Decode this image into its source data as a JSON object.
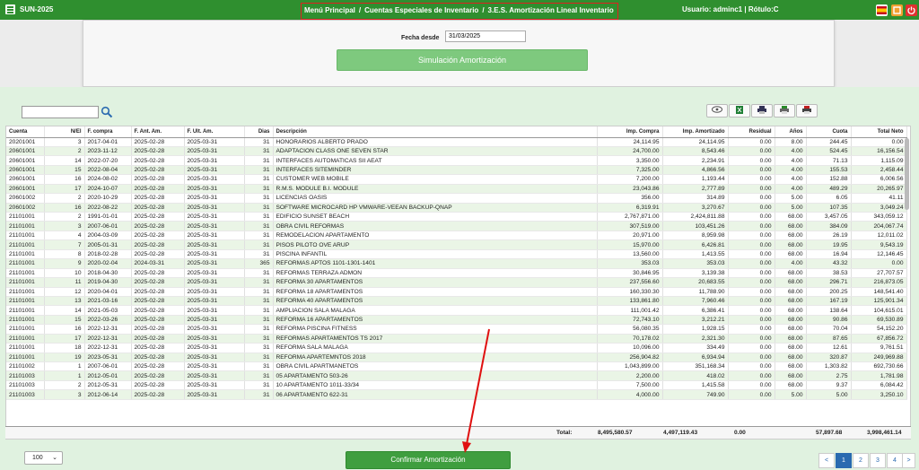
{
  "header": {
    "app_name": "SUN-2025",
    "breadcrumb": [
      "Menú Principal",
      "Cuentas Especiales de Inventario",
      "3.E.S. Amortización Lineal Inventario"
    ],
    "breadcrumb_sep": "/",
    "user_info": "Usuario: adminc1 | Rótulo:C",
    "colors": {
      "bar": "#2f8f2f",
      "highlight": "#e02020"
    }
  },
  "form": {
    "fecha_label": "Fecha desde",
    "fecha_value": "31/03/2025",
    "sim_button": "Simulación Amortización"
  },
  "table": {
    "columns": [
      "Cuenta",
      "N/El",
      "F. compra",
      "F. Ant. Am.",
      "F. Ult. Am.",
      "Dias",
      "Descripción",
      "Imp. Compra",
      "Imp. Amortizado",
      "Residual",
      "Años",
      "Cuota",
      "Total Neto"
    ],
    "rows": [
      [
        "20201001",
        "3",
        "2017-04-01",
        "2025-02-28",
        "2025-03-31",
        "31",
        "HONORARIOS ALBERTO PRADO",
        "24,114.95",
        "24,114.95",
        "0.00",
        "8.00",
        "244.45",
        "0.00"
      ],
      [
        "20601001",
        "2",
        "2023-11-12",
        "2025-02-28",
        "2025-03-31",
        "31",
        "ADAPTACION CLASS ONE SEVEN STAR",
        "24,700.00",
        "8,543.46",
        "0.00",
        "4.00",
        "524.45",
        "16,156.54"
      ],
      [
        "20601001",
        "14",
        "2022-07-20",
        "2025-02-28",
        "2025-03-31",
        "31",
        "INTERFACES AUTOMATICAS SII AEAT",
        "3,350.00",
        "2,234.91",
        "0.00",
        "4.00",
        "71.13",
        "1,115.09"
      ],
      [
        "20601001",
        "15",
        "2022-08-04",
        "2025-02-28",
        "2025-03-31",
        "31",
        "INTERFACES SITEMINDER",
        "7,325.00",
        "4,866.56",
        "0.00",
        "4.00",
        "155.53",
        "2,458.44"
      ],
      [
        "20601001",
        "16",
        "2024-08-02",
        "2025-02-28",
        "2025-03-31",
        "31",
        "CUSTOMER WEB MOBILE",
        "7,200.00",
        "1,193.44",
        "0.00",
        "4.00",
        "152.88",
        "6,006.56"
      ],
      [
        "20601001",
        "17",
        "2024-10-07",
        "2025-02-28",
        "2025-03-31",
        "31",
        "R.M.S. MODULE B.I. MODULE",
        "23,043.86",
        "2,777.89",
        "0.00",
        "4.00",
        "489.29",
        "20,265.97"
      ],
      [
        "20601002",
        "2",
        "2020-10-29",
        "2025-02-28",
        "2025-03-31",
        "31",
        "LICENCIAS OASIS",
        "356.00",
        "314.89",
        "0.00",
        "5.00",
        "6.05",
        "41.11"
      ],
      [
        "20601002",
        "16",
        "2022-08-22",
        "2025-02-28",
        "2025-03-31",
        "31",
        "SOFTWARE MICROCARD HP VMWARE-VEEAN BACKUP-QNAP",
        "6,319.91",
        "3,270.67",
        "0.00",
        "5.00",
        "107.35",
        "3,049.24"
      ],
      [
        "21101001",
        "2",
        "1991-01-01",
        "2025-02-28",
        "2025-03-31",
        "31",
        "EDIFICIO SUNSET BEACH",
        "2,767,871.00",
        "2,424,811.88",
        "0.00",
        "68.00",
        "3,457.05",
        "343,059.12"
      ],
      [
        "21101001",
        "3",
        "2007-06-01",
        "2025-02-28",
        "2025-03-31",
        "31",
        "OBRA CIVIL REFORMAS",
        "307,519.00",
        "103,451.26",
        "0.00",
        "68.00",
        "384.09",
        "204,067.74"
      ],
      [
        "21101001",
        "4",
        "2004-03-09",
        "2025-02-28",
        "2025-03-31",
        "31",
        "REMODELACION APARTAMENTO",
        "20,971.00",
        "8,959.98",
        "0.00",
        "68.00",
        "26.19",
        "12,011.02"
      ],
      [
        "21101001",
        "7",
        "2005-01-31",
        "2025-02-28",
        "2025-03-31",
        "31",
        "PISOS PILOTO OVE ARUP",
        "15,970.00",
        "6,426.81",
        "0.00",
        "68.00",
        "19.95",
        "9,543.19"
      ],
      [
        "21101001",
        "8",
        "2018-02-28",
        "2025-02-28",
        "2025-03-31",
        "31",
        "PISCINA INFANTIL",
        "13,560.00",
        "1,413.55",
        "0.00",
        "68.00",
        "16.94",
        "12,146.45"
      ],
      [
        "21101001",
        "9",
        "2020-02-04",
        "2024-03-31",
        "2025-03-31",
        "365",
        "REFORMAS APTOS 1101-1301-1401",
        "353.03",
        "353.03",
        "0.00",
        "4.00",
        "43.32",
        "0.00"
      ],
      [
        "21101001",
        "10",
        "2018-04-30",
        "2025-02-28",
        "2025-03-31",
        "31",
        "REFORMAS TERRAZA ADMON",
        "30,846.95",
        "3,139.38",
        "0.00",
        "68.00",
        "38.53",
        "27,707.57"
      ],
      [
        "21101001",
        "11",
        "2019-04-30",
        "2025-02-28",
        "2025-03-31",
        "31",
        "REFORMA 30 APARTAMENTOS",
        "237,556.60",
        "20,683.55",
        "0.00",
        "68.00",
        "296.71",
        "216,873.05"
      ],
      [
        "21101001",
        "12",
        "2020-04-01",
        "2025-02-28",
        "2025-03-31",
        "31",
        "REFORMA 18 APARTAMENTOS",
        "160,330.30",
        "11,788.90",
        "0.00",
        "68.00",
        "200.25",
        "148,541.40"
      ],
      [
        "21101001",
        "13",
        "2021-03-16",
        "2025-02-28",
        "2025-03-31",
        "31",
        "REFORMA 40 APARTAMENTOS",
        "133,861.80",
        "7,960.46",
        "0.00",
        "68.00",
        "167.19",
        "125,901.34"
      ],
      [
        "21101001",
        "14",
        "2021-05-03",
        "2025-02-28",
        "2025-03-31",
        "31",
        "AMPLIACION SALA MALAGA",
        "111,001.42",
        "6,386.41",
        "0.00",
        "68.00",
        "138.64",
        "104,615.01"
      ],
      [
        "21101001",
        "15",
        "2022-03-26",
        "2025-02-28",
        "2025-03-31",
        "31",
        "REFORMA 16 APARTAMENTOS",
        "72,743.10",
        "3,212.21",
        "0.00",
        "68.00",
        "90.86",
        "69,530.89"
      ],
      [
        "21101001",
        "16",
        "2022-12-31",
        "2025-02-28",
        "2025-03-31",
        "31",
        "REFORMA PISCINA FITNESS",
        "56,080.35",
        "1,928.15",
        "0.00",
        "68.00",
        "70.04",
        "54,152.20"
      ],
      [
        "21101001",
        "17",
        "2022-12-31",
        "2025-02-28",
        "2025-03-31",
        "31",
        "REFORMAS APARTAMENTOS TS 2017",
        "70,178.02",
        "2,321.30",
        "0.00",
        "68.00",
        "87.65",
        "67,856.72"
      ],
      [
        "21101001",
        "18",
        "2022-12-31",
        "2025-02-28",
        "2025-03-31",
        "31",
        "REFORMA SALA MALAGA",
        "10,096.00",
        "334.49",
        "0.00",
        "68.00",
        "12.61",
        "9,761.51"
      ],
      [
        "21101001",
        "19",
        "2023-05-31",
        "2025-02-28",
        "2025-03-31",
        "31",
        "REFORMA APARTEMNTOS 2018",
        "256,904.82",
        "6,934.94",
        "0.00",
        "68.00",
        "320.87",
        "249,969.88"
      ],
      [
        "21101002",
        "1",
        "2007-06-01",
        "2025-02-28",
        "2025-03-31",
        "31",
        "OBRA CIVIL APARTMANETOS",
        "1,043,899.00",
        "351,168.34",
        "0.00",
        "68.00",
        "1,303.82",
        "692,730.66"
      ],
      [
        "21101003",
        "1",
        "2012-05-01",
        "2025-02-28",
        "2025-03-31",
        "31",
        "05 APARTAMENTO 503-26",
        "2,200.00",
        "418.02",
        "0.00",
        "68.00",
        "2.75",
        "1,781.98"
      ],
      [
        "21101003",
        "2",
        "2012-05-31",
        "2025-02-28",
        "2025-03-31",
        "31",
        "10 APARTAMENTO 1011-33/34",
        "7,500.00",
        "1,415.58",
        "0.00",
        "68.00",
        "9.37",
        "6,084.42"
      ],
      [
        "21101003",
        "3",
        "2012-06-14",
        "2025-02-28",
        "2025-03-31",
        "31",
        "06 APARTAMENTO 622-31",
        "4,000.00",
        "749.90",
        "0.00",
        "5.00",
        "5.00",
        "3,250.10"
      ]
    ],
    "totals": {
      "label": "Total:",
      "imp_compra": "8,495,580.57",
      "imp_amortizado": "4,497,119.43",
      "residual": "0.00",
      "cuota": "57,897.68",
      "total_neto": "3,998,461.14"
    }
  },
  "footer": {
    "page_size": "100",
    "confirm_button": "Confirmar Amortización",
    "pager": {
      "prev": "<",
      "pages": [
        "1",
        "2",
        "3",
        "4"
      ],
      "next": ">"
    }
  },
  "icons": [
    "menu-icon",
    "search-icon",
    "eye-icon",
    "excel-icon",
    "print-icon",
    "printer-color-icon",
    "pdf-icon",
    "flag-es-icon",
    "home-icon",
    "power-icon"
  ]
}
